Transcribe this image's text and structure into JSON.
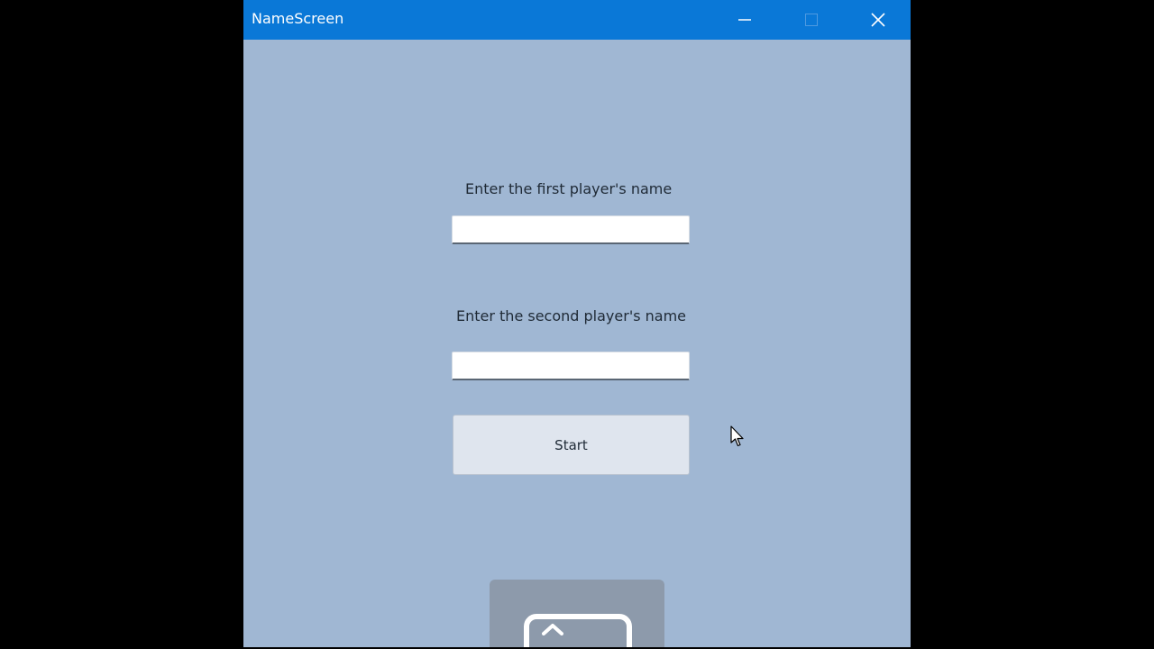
{
  "window": {
    "title": "NameScreen",
    "controls": {
      "minimize": "minimize-icon",
      "maximize": "maximize-icon",
      "close": "close-icon"
    }
  },
  "form": {
    "first_player_label": "Enter the first player's name",
    "first_player_value": "",
    "second_player_label": "Enter the second player's name",
    "second_player_value": "",
    "start_label": "Start"
  },
  "colors": {
    "titlebar": "#0a78d7",
    "background": "#a0b7d3",
    "button": "#dfe5ee"
  }
}
